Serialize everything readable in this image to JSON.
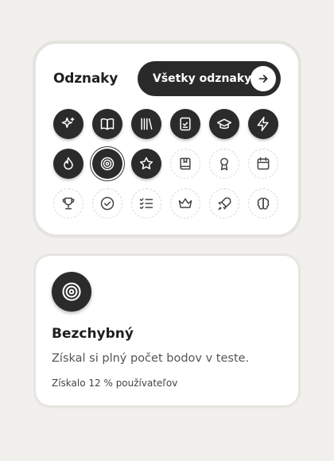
{
  "badges_card": {
    "title": "Odznaky",
    "all_button_label": "Všetky odznaky"
  },
  "badges": [
    {
      "icon": "sparkles-icon",
      "earned": true
    },
    {
      "icon": "open-book-icon",
      "earned": true
    },
    {
      "icon": "library-icon",
      "earned": true
    },
    {
      "icon": "clipboard-check-icon",
      "earned": true
    },
    {
      "icon": "graduation-cap-icon",
      "earned": true
    },
    {
      "icon": "lightning-icon",
      "earned": true
    },
    {
      "icon": "flame-icon",
      "earned": true
    },
    {
      "icon": "target-icon",
      "earned": true,
      "selected": true
    },
    {
      "icon": "star-icon",
      "earned": true
    },
    {
      "icon": "book-bookmark-icon",
      "earned": false
    },
    {
      "icon": "award-ribbon-icon",
      "earned": false
    },
    {
      "icon": "calendar-icon",
      "earned": false
    },
    {
      "icon": "trophy-icon",
      "earned": false
    },
    {
      "icon": "check-circle-icon",
      "earned": false
    },
    {
      "icon": "checklist-icon",
      "earned": false
    },
    {
      "icon": "crown-icon",
      "earned": false
    },
    {
      "icon": "rocket-icon",
      "earned": false
    },
    {
      "icon": "brain-icon",
      "earned": false
    }
  ],
  "detail": {
    "icon": "target-icon",
    "name": "Bezchybný",
    "description": "Získal si plný počet bodov v teste.",
    "stat": "Získalo 12 % používateľov"
  },
  "colors": {
    "background": "#f1f0ed",
    "earned_badge": "#2b2b2b",
    "locked_badge_border": "#d8d8d8"
  }
}
